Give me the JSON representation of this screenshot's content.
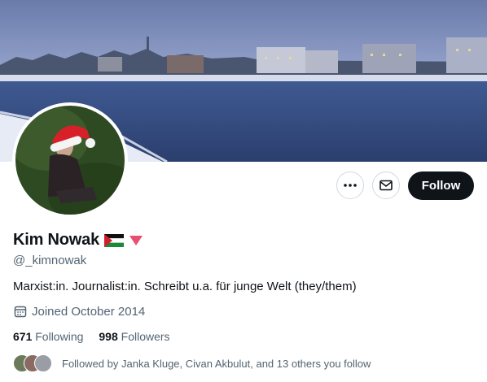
{
  "profile": {
    "display_name": "Kim Nowak",
    "handle": "@_kimnowak",
    "bio": "Marxist:in. Journalist:in. Schreibt u.a. für junge Welt (they/them)",
    "joined": "Joined October 2014",
    "following_count": "671",
    "following_label": "Following",
    "followers_count": "998",
    "followers_label": "Followers",
    "followed_by": "Followed by Janka Kluge, Civan Akbulut, and 13 others you follow",
    "name_badges": [
      "palestine-flag-icon",
      "red-triangle-icon"
    ]
  },
  "actions": {
    "follow_label": "Follow",
    "more_icon": "more-icon",
    "message_icon": "mail-icon"
  },
  "colors": {
    "primary_text": "#0f1419",
    "secondary_text": "#536471",
    "follow_bg": "#0f1419",
    "border": "#cfd9de",
    "triangle": "#e8506e"
  }
}
